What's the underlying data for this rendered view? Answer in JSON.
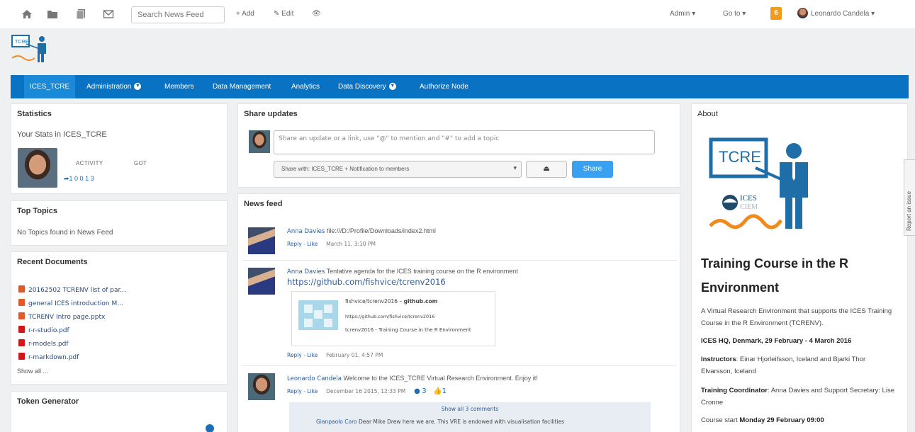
{
  "topbar": {
    "search_placeholder": "Search News Feed",
    "add_label": "+ Add",
    "edit_label": "Edit",
    "admin_label": "Admin",
    "goto_label": "Go to",
    "notification_count": "6",
    "user_name": "Leonardo Candela"
  },
  "nav": {
    "items": [
      "ICES_TCRE",
      "Administration",
      "Members",
      "Data Management",
      "Analytics",
      "Data Discovery",
      "Authorize Node"
    ]
  },
  "statistics": {
    "title": "Statistics",
    "subtitle": "Your Stats in ICES_TCRE",
    "activity_label": "ACTIVITY",
    "got_label": "GOT",
    "counts": "1  0  0   1  3"
  },
  "top_topics": {
    "title": "Top Topics",
    "empty_text": "No Topics found in News Feed"
  },
  "recent_documents": {
    "title": "Recent Documents",
    "items": [
      {
        "name": "20162502 TCRENV list of par...",
        "type": "word"
      },
      {
        "name": "general ICES introduction M...",
        "type": "ppt"
      },
      {
        "name": "TCRENV Intro page.pptx",
        "type": "ppt"
      },
      {
        "name": "r-r-studio.pdf",
        "type": "pdf"
      },
      {
        "name": "r-models.pdf",
        "type": "pdf"
      },
      {
        "name": "r-markdown.pdf",
        "type": "pdf"
      }
    ],
    "show_all": "Show all ..."
  },
  "token_generator": {
    "title": "Token Generator"
  },
  "share": {
    "title": "Share updates",
    "placeholder": "Share an update or a link, use \"@\" to mention and \"#\" to add a topic",
    "share_with": "Share with: ICES_TCRE + Notification to members",
    "button_label": "Share"
  },
  "newsfeed": {
    "title": "News feed",
    "posts": [
      {
        "author": "Anna Davies",
        "text": "file:///D:/Profile/Downloads/index2.html",
        "reply": "Reply",
        "like": "Like",
        "date": "March 11, 3:10 PM"
      },
      {
        "author": "Anna Davies",
        "text": "Tentative agenda for the ICES training course on the R environment",
        "url": "https://github.com/fishvice/tcrenv2016",
        "reply": "Reply",
        "like": "Like",
        "date": "February 01, 4:57 PM",
        "card": {
          "title": "fishvice/tcrenv2016",
          "site": "github.com",
          "url": "https://github.com/fishvice/tcrenv2016",
          "desc": "tcrenv2016 - Training Course in the R Environment"
        }
      },
      {
        "author": "Leonardo Candela",
        "text": "Welcome to the ICES_TCRE Virtual Research Environment. Enjoy it!",
        "reply": "Reply",
        "like": "Like",
        "date": "December 16 2015, 12:33 PM",
        "comments": "3",
        "likes": "1"
      }
    ],
    "show_all_comments": "Show all 3 comments",
    "comment_author": "Gianpaolo Coro",
    "comment_text": "Dear Mike Drew here we are. This VRE is endowed with visualisation facilities"
  },
  "about": {
    "title_label": "About",
    "logo_text": "TCRE",
    "ices_text": "ICES",
    "ciem_text": "CIEM",
    "heading": "Training Course in the R Environment",
    "description": "A Virtual Research Environment that supports the ICES Training Course in the R Environment (TCRENV).",
    "location": "ICES HQ, Denmark, 29 February - 4 March 2016",
    "instructors_label": "Instructors",
    "instructors": ": Einar Hjorleifsson, Iceland and Bjarki Thor Elvarsson, Iceland",
    "coordinator_label": "Training Coordinator",
    "coordinator": ": Anna Davies and Support Secretary: Lise Cronne",
    "course_start_label": "Course start",
    "course_start": "Monday 29 February 09:00"
  },
  "report_issue": "Report an issue"
}
